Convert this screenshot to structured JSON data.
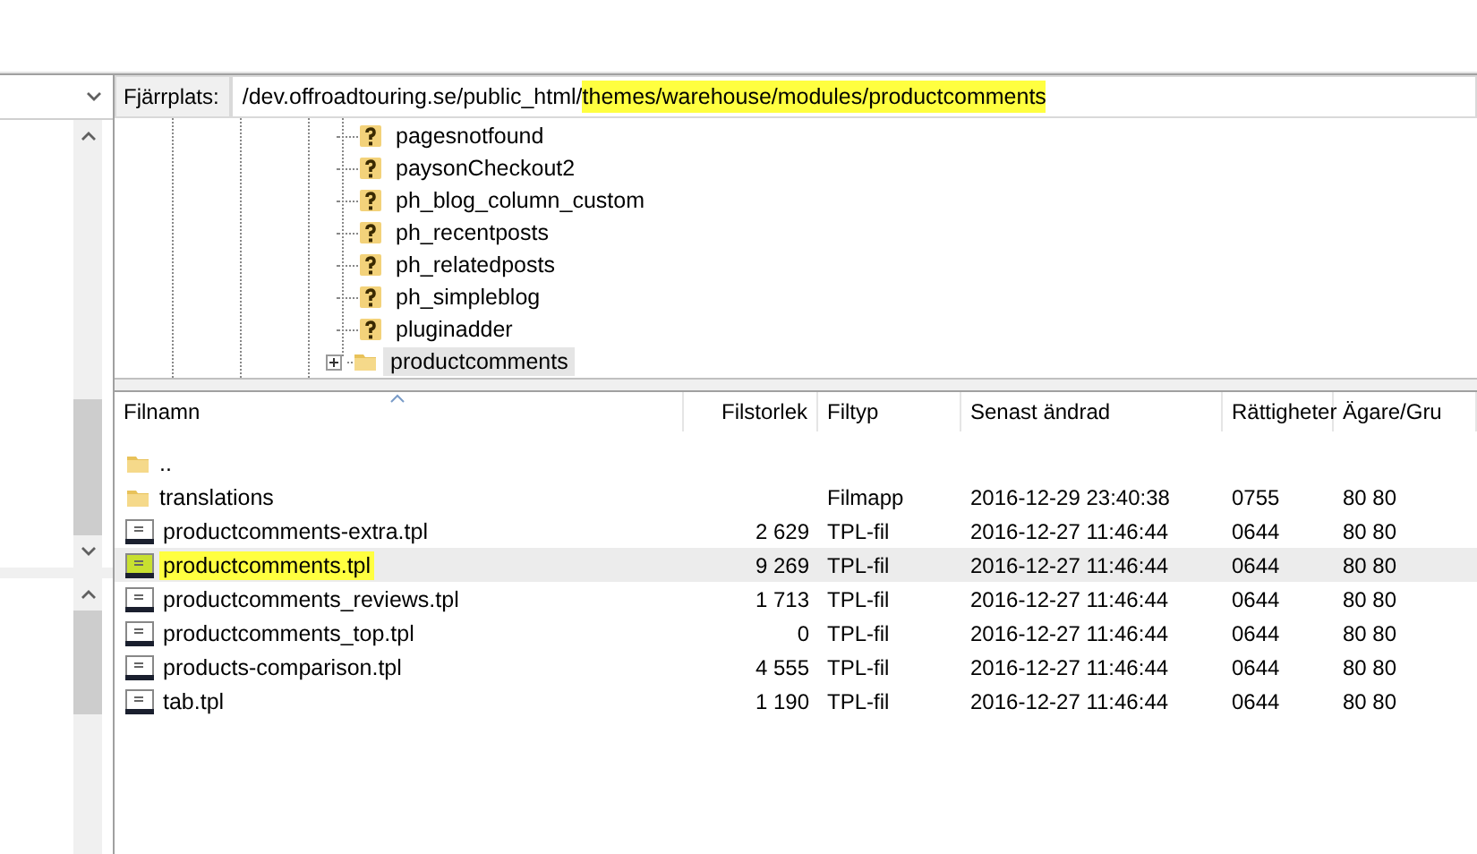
{
  "remote_site": {
    "label": "Fjärrplats:",
    "path": [
      {
        "text": "/dev.offroadtouring.se/public_html/",
        "highlighted": false
      },
      {
        "text": "themes/warehouse/modules/productcomments",
        "highlighted": true
      }
    ]
  },
  "tree": {
    "items": [
      {
        "name": "pagesnotfound",
        "kind": "unknown",
        "selected": false,
        "expandable": false
      },
      {
        "name": "paysonCheckout2",
        "kind": "unknown",
        "selected": false,
        "expandable": false
      },
      {
        "name": "ph_blog_column_custom",
        "kind": "unknown",
        "selected": false,
        "expandable": false
      },
      {
        "name": "ph_recentposts",
        "kind": "unknown",
        "selected": false,
        "expandable": false
      },
      {
        "name": "ph_relatedposts",
        "kind": "unknown",
        "selected": false,
        "expandable": false
      },
      {
        "name": "ph_simpleblog",
        "kind": "unknown",
        "selected": false,
        "expandable": false
      },
      {
        "name": "pluginadder",
        "kind": "unknown",
        "selected": false,
        "expandable": false
      },
      {
        "name": "productcomments",
        "kind": "folder",
        "selected": true,
        "expandable": true
      }
    ]
  },
  "file_list": {
    "columns": [
      "Filnamn",
      "Filstorlek",
      "Filtyp",
      "Senast ändrad",
      "Rättigheter",
      "Ägare/Gru"
    ],
    "rows": [
      {
        "kind": "folder",
        "name": "..",
        "selected": false,
        "highlighted": false
      },
      {
        "kind": "folder",
        "name": "translations",
        "type": "Filmapp",
        "modified": "2016-12-29 23:40:38",
        "permissions": "0755",
        "owner": "80 80",
        "selected": false,
        "highlighted": false
      },
      {
        "kind": "file",
        "name": "productcomments-extra.tpl",
        "size": "2 629",
        "type": "TPL-fil",
        "modified": "2016-12-27 11:46:44",
        "permissions": "0644",
        "owner": "80 80",
        "selected": false,
        "highlighted": false
      },
      {
        "kind": "file",
        "name": "productcomments.tpl",
        "size": "9 269",
        "type": "TPL-fil",
        "modified": "2016-12-27 11:46:44",
        "permissions": "0644",
        "owner": "80 80",
        "selected": true,
        "highlighted": true
      },
      {
        "kind": "file",
        "name": "productcomments_reviews.tpl",
        "size": "1 713",
        "type": "TPL-fil",
        "modified": "2016-12-27 11:46:44",
        "permissions": "0644",
        "owner": "80 80",
        "selected": false,
        "highlighted": false
      },
      {
        "kind": "file",
        "name": "productcomments_top.tpl",
        "size": "0",
        "type": "TPL-fil",
        "modified": "2016-12-27 11:46:44",
        "permissions": "0644",
        "owner": "80 80",
        "selected": false,
        "highlighted": false
      },
      {
        "kind": "file",
        "name": "products-comparison.tpl",
        "size": "4 555",
        "type": "TPL-fil",
        "modified": "2016-12-27 11:46:44",
        "permissions": "0644",
        "owner": "80 80",
        "selected": false,
        "highlighted": false
      },
      {
        "kind": "file",
        "name": "tab.tpl",
        "size": "1 190",
        "type": "TPL-fil",
        "modified": "2016-12-27 11:46:44",
        "permissions": "0644",
        "owner": "80 80",
        "selected": false,
        "highlighted": false
      }
    ]
  }
}
